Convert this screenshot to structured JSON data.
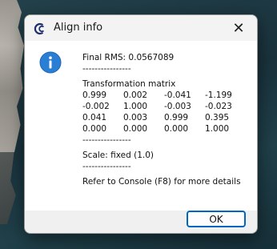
{
  "dialog": {
    "title": "Align info",
    "close_glyph": "✕",
    "icons": {
      "app": "cloudcompare-app-icon",
      "message": "info-icon"
    },
    "message": {
      "rms": "Final RMS: 0.0567089",
      "sep1": "----------------",
      "matrix_title": "Transformation matrix",
      "matrix": [
        [
          "0.999",
          "0.002",
          "-0.041",
          "-1.199"
        ],
        [
          "-0.002",
          "1.000",
          "-0.003",
          "-0.023"
        ],
        [
          "0.041",
          "0.003",
          "0.999",
          "0.395"
        ],
        [
          "0.000",
          "0.000",
          "0.000",
          "1.000"
        ]
      ],
      "sep2": "----------------",
      "scale": "Scale: fixed (1.0)",
      "sep3": "----------------",
      "console_note": "Refer to Console (F8) for more details"
    },
    "ok_label": "OK",
    "accent_color": "#0067c0"
  }
}
